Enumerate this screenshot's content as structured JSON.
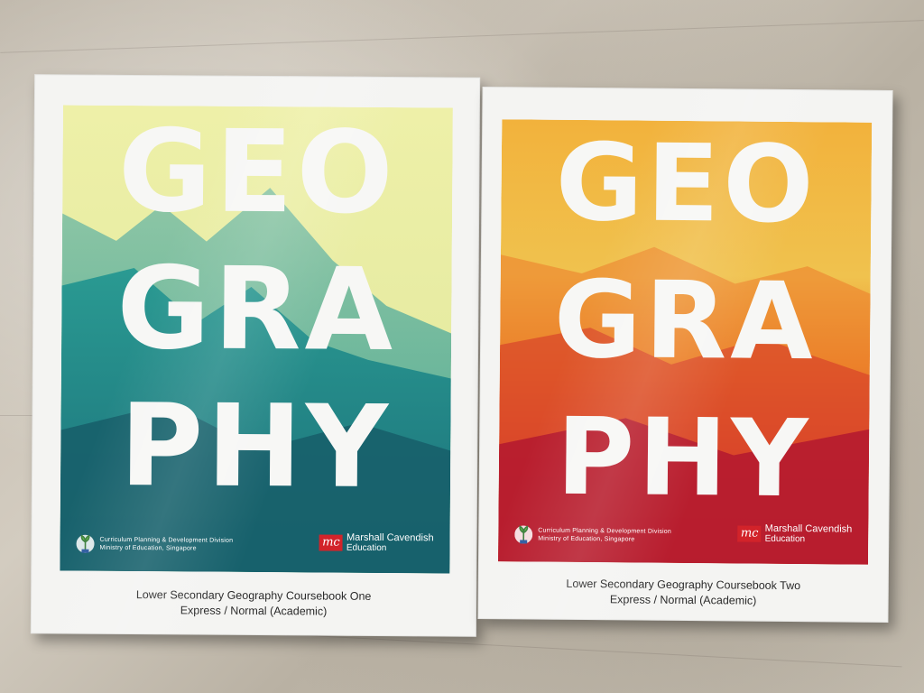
{
  "books": [
    {
      "title_lines": [
        "GEO",
        "GRA",
        "PHY"
      ],
      "org_lines": [
        "Curriculum Planning & Development Division",
        "Ministry of Education, Singapore"
      ],
      "publisher_mark": "mc",
      "publisher_name": "Marshall Cavendish",
      "publisher_sub": "Education",
      "caption_line1": "Lower Secondary Geography Coursebook One",
      "caption_line2": "Express / Normal (Academic)",
      "colors": {
        "sky": "#e6ea9c",
        "mountain": "#2a8f8c",
        "base": "#1f6e78"
      }
    },
    {
      "title_lines": [
        "GEO",
        "GRA",
        "PHY"
      ],
      "org_lines": [
        "Curriculum Planning & Development Division",
        "Ministry of Education, Singapore"
      ],
      "publisher_mark": "mc",
      "publisher_name": "Marshall Cavendish",
      "publisher_sub": "Education",
      "caption_line1": "Lower Secondary Geography Coursebook Two",
      "caption_line2": "Express / Normal (Academic)",
      "colors": {
        "sky": "#f0c04a",
        "mountain": "#e2652a",
        "base": "#b8182e"
      }
    }
  ]
}
